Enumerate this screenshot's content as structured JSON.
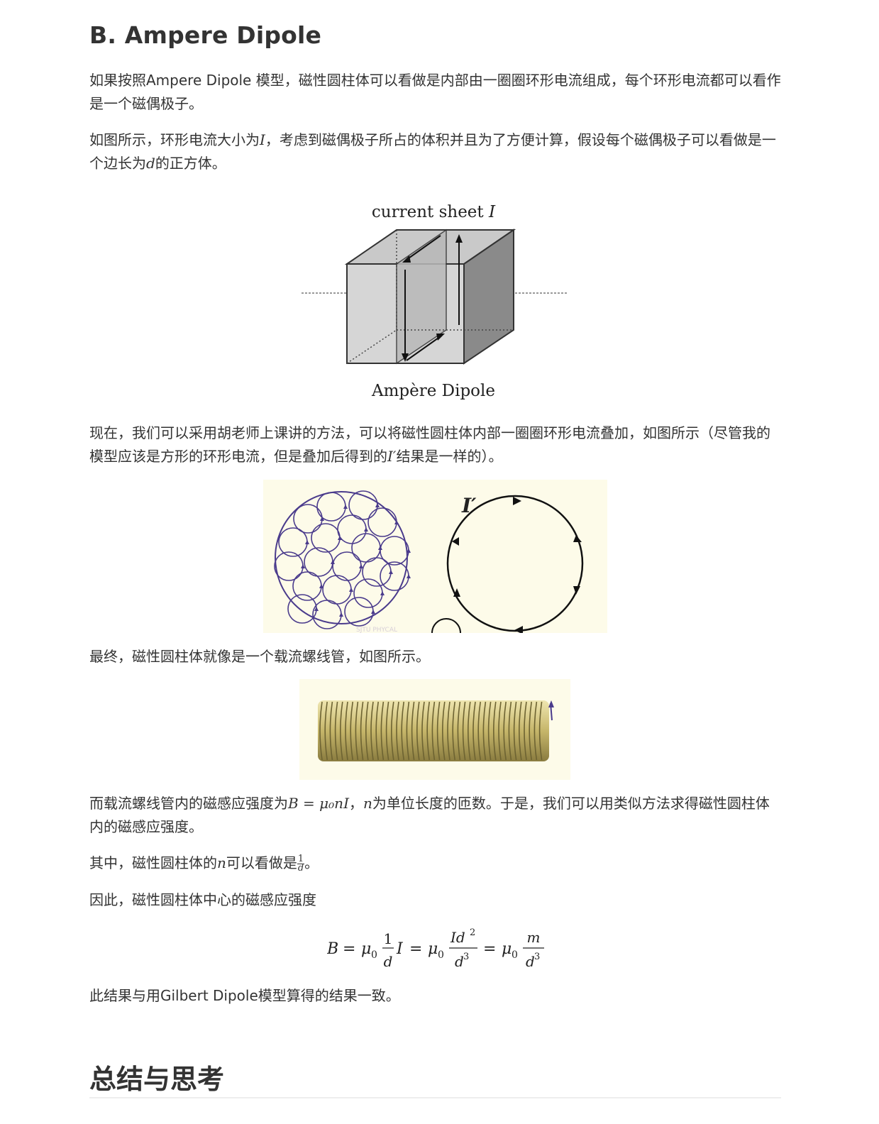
{
  "section_heading": "B. Ampere Dipole",
  "para1": "如果按照Ampere Dipole 模型，磁性圆柱体可以看做是内部由一圈圈环形电流组成，每个环形电流都可以看作是一个磁偶极子。",
  "para2": {
    "before": "如图所示，环形电流大小为",
    "var_I": "I",
    "middle": "，考虑到磁偶极子所占的体积并且为了方便计算，假设每个磁偶极子可以看做是一个边长为",
    "var_d": "d",
    "after": "的正方体。"
  },
  "figure1": {
    "label_top": "current sheet",
    "label_top_var": "I",
    "label_bottom": "Ampère Dipole"
  },
  "para3": {
    "before": "现在，我们可以采用胡老师上课讲的方法，可以将磁性圆柱体内部一圈圈环形电流叠加，如图所示（尽管我的模型应该是方形的环形电流，但是叠加后得到的",
    "var": "I′",
    "after": "结果是一样的）。"
  },
  "figure2": {
    "label": "I′",
    "watermark": "SJTU PHYCAL"
  },
  "para4": "最终，磁性圆柱体就像是一个载流螺线管，如图所示。",
  "para5": {
    "before": "而载流螺线管内的磁感应强度为",
    "formula": "B = μ₀nI",
    "middle_sep": "，",
    "var_n": "n",
    "after": "为单位长度的匝数。于是，我们可以用类似方法求得磁性圆柱体内的磁感应强度。"
  },
  "para6": {
    "before": "其中，磁性圆柱体的",
    "var_n": "n",
    "middle": "可以看做是",
    "frac_num": "1",
    "frac_den": "d",
    "after": "。"
  },
  "para7": "因此，磁性圆柱体中心的磁感应强度",
  "equation": {
    "B": "B",
    "eq": "=",
    "mu0": "μ",
    "sub0": "0",
    "one": "1",
    "d": "d",
    "I": "I",
    "Id2": "Id",
    "sq": "2",
    "d3": "d",
    "cube": "3",
    "m": "m"
  },
  "para8": "此结果与用Gilbert Dipole模型算得的结果一致。",
  "summary_heading": "总结与思考",
  "colors": {
    "text": "#333333",
    "circle_stroke": "#4a3b8c",
    "figure_bg": "#fdfbe9",
    "coil": "#c8b86a"
  }
}
